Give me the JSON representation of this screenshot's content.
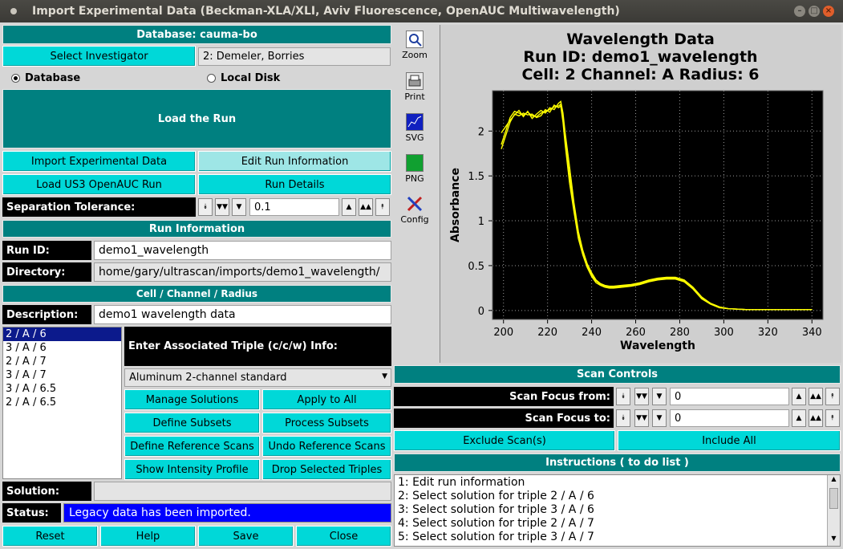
{
  "window": {
    "title": "Import Experimental Data (Beckman-XLA/XLI, Aviv Fluorescence, OpenAUC Multiwavelength)"
  },
  "database": {
    "header": "Database: cauma-bo",
    "select_investigator": "Select Investigator",
    "investigator": "2: Demeler, Borries",
    "radio_database": "Database",
    "radio_local": "Local Disk"
  },
  "actions": {
    "load_run": "Load the Run",
    "import_exp": "Import Experimental Data",
    "edit_run_info": "Edit Run Information",
    "load_us3": "Load US3 OpenAUC Run",
    "run_details": "Run Details"
  },
  "separation": {
    "label": "Separation Tolerance:",
    "value": "0.1"
  },
  "run_info": {
    "header": "Run Information",
    "run_id_label": "Run ID:",
    "run_id": "demo1_wavelength",
    "dir_label": "Directory:",
    "dir": "home/gary/ultrascan/imports/demo1_wavelength/"
  },
  "ccr": {
    "header": "Cell / Channel / Radius",
    "desc_label": "Description:",
    "desc": "demo1 wavelength data",
    "triples": [
      "2 / A / 6",
      "3 / A / 6",
      "2 / A / 7",
      "3 / A / 7",
      "3 / A / 6.5",
      "2 / A / 6.5"
    ],
    "assoc_label": "Enter Associated Triple (c/c/w) Info:",
    "centerpiece": "Aluminum 2-channel standard"
  },
  "triple_buttons": {
    "manage_solutions": "Manage Solutions",
    "apply_all": "Apply to All",
    "define_subsets": "Define Subsets",
    "process_subsets": "Process Subsets",
    "define_ref": "Define Reference Scans",
    "undo_ref": "Undo Reference Scans",
    "show_intensity": "Show Intensity Profile",
    "drop_triples": "Drop Selected Triples"
  },
  "solution": {
    "label": "Solution:",
    "value": ""
  },
  "status": {
    "label": "Status:",
    "value": "Legacy data has been imported."
  },
  "bottom_buttons": {
    "reset": "Reset",
    "help": "Help",
    "save": "Save",
    "close": "Close"
  },
  "toolbar": {
    "zoom": "Zoom",
    "print": "Print",
    "svg": "SVG",
    "png": "PNG",
    "config": "Config"
  },
  "scan_controls": {
    "header": "Scan Controls",
    "focus_from_label": "Scan Focus from:",
    "focus_from": "0",
    "focus_to_label": "Scan Focus to:",
    "focus_to": "0",
    "exclude": "Exclude Scan(s)",
    "include_all": "Include All"
  },
  "instructions": {
    "header": "Instructions ( to do list )",
    "items": [
      "1: Edit run information",
      "2: Select solution for triple 2 / A / 6",
      "3: Select solution for triple 3 / A / 6",
      "4: Select solution for triple 2 / A / 7",
      "5: Select solution for triple 3 / A / 7"
    ]
  },
  "colors": {
    "teal": "#008080",
    "cyan_button": "#00d8d8",
    "plot_bg": "#000000",
    "curve": "#ffff00",
    "status_bg": "#0000ff"
  },
  "chart_data": {
    "type": "line",
    "title_lines": [
      "Wavelength Data",
      "Run ID: demo1_wavelength",
      "Cell: 2  Channel: A  Radius: 6"
    ],
    "xlabel": "Wavelength",
    "ylabel": "Absorbance",
    "xlim": [
      195,
      345
    ],
    "ylim": [
      -0.1,
      2.45
    ],
    "xticks": [
      200,
      220,
      240,
      260,
      280,
      300,
      320,
      340
    ],
    "yticks": [
      0,
      0.5,
      1,
      1.5,
      2
    ],
    "ytick_labels": [
      "0",
      "0.5",
      "1",
      "1.5",
      "2"
    ],
    "grid": true,
    "series": [
      {
        "x": [
          199,
          201,
          203,
          205,
          207,
          209,
          211,
          213,
          215,
          217,
          219,
          221,
          223,
          225,
          226,
          227,
          228,
          230,
          232,
          234,
          236,
          238,
          240,
          242,
          244,
          246,
          248,
          250,
          254,
          258,
          262,
          266,
          270,
          274,
          278,
          282,
          286,
          290,
          294,
          298,
          302,
          310,
          320,
          330,
          340
        ],
        "y": [
          1.85,
          2.0,
          2.15,
          2.22,
          2.2,
          2.18,
          2.21,
          2.17,
          2.16,
          2.2,
          2.22,
          2.24,
          2.27,
          2.28,
          2.3,
          2.15,
          1.9,
          1.5,
          1.15,
          0.85,
          0.65,
          0.5,
          0.4,
          0.33,
          0.29,
          0.27,
          0.26,
          0.26,
          0.27,
          0.28,
          0.3,
          0.33,
          0.35,
          0.36,
          0.36,
          0.33,
          0.25,
          0.14,
          0.08,
          0.04,
          0.02,
          0.01,
          0.01,
          0.01,
          0.01
        ]
      },
      {
        "x": [
          199,
          201,
          203,
          205,
          207,
          209,
          211,
          213,
          215,
          217,
          219,
          221,
          223,
          225,
          226,
          227,
          228,
          230,
          232,
          234,
          236,
          238,
          240,
          242,
          244,
          246,
          248,
          250,
          254,
          258,
          262,
          266,
          270,
          274,
          278,
          282,
          286,
          290,
          294,
          298,
          302,
          310,
          320,
          330,
          340
        ],
        "y": [
          1.98,
          2.05,
          2.12,
          2.18,
          2.23,
          2.16,
          2.22,
          2.14,
          2.19,
          2.23,
          2.2,
          2.26,
          2.24,
          2.31,
          2.33,
          2.2,
          1.98,
          1.6,
          1.2,
          0.88,
          0.67,
          0.52,
          0.42,
          0.34,
          0.3,
          0.28,
          0.27,
          0.27,
          0.28,
          0.29,
          0.31,
          0.34,
          0.36,
          0.37,
          0.37,
          0.34,
          0.26,
          0.15,
          0.08,
          0.04,
          0.02,
          0.01,
          0.01,
          0.01,
          0.01
        ]
      },
      {
        "x": [
          199,
          201,
          203,
          205,
          207,
          209,
          211,
          213,
          215,
          217,
          219,
          221,
          223,
          225,
          226,
          227,
          228,
          230,
          232,
          234,
          236,
          238,
          240,
          242,
          244,
          246,
          248,
          250,
          254,
          258,
          262,
          266,
          270,
          274,
          278,
          282,
          286,
          290,
          294,
          298,
          302,
          310,
          320,
          330,
          340
        ],
        "y": [
          1.8,
          1.95,
          2.1,
          2.19,
          2.17,
          2.2,
          2.18,
          2.19,
          2.15,
          2.17,
          2.24,
          2.21,
          2.29,
          2.26,
          2.28,
          2.1,
          1.85,
          1.42,
          1.1,
          0.8,
          0.62,
          0.48,
          0.38,
          0.31,
          0.28,
          0.26,
          0.25,
          0.25,
          0.26,
          0.27,
          0.29,
          0.32,
          0.34,
          0.35,
          0.35,
          0.32,
          0.24,
          0.13,
          0.07,
          0.03,
          0.02,
          0.01,
          0.01,
          0.01,
          0.01
        ]
      }
    ]
  }
}
